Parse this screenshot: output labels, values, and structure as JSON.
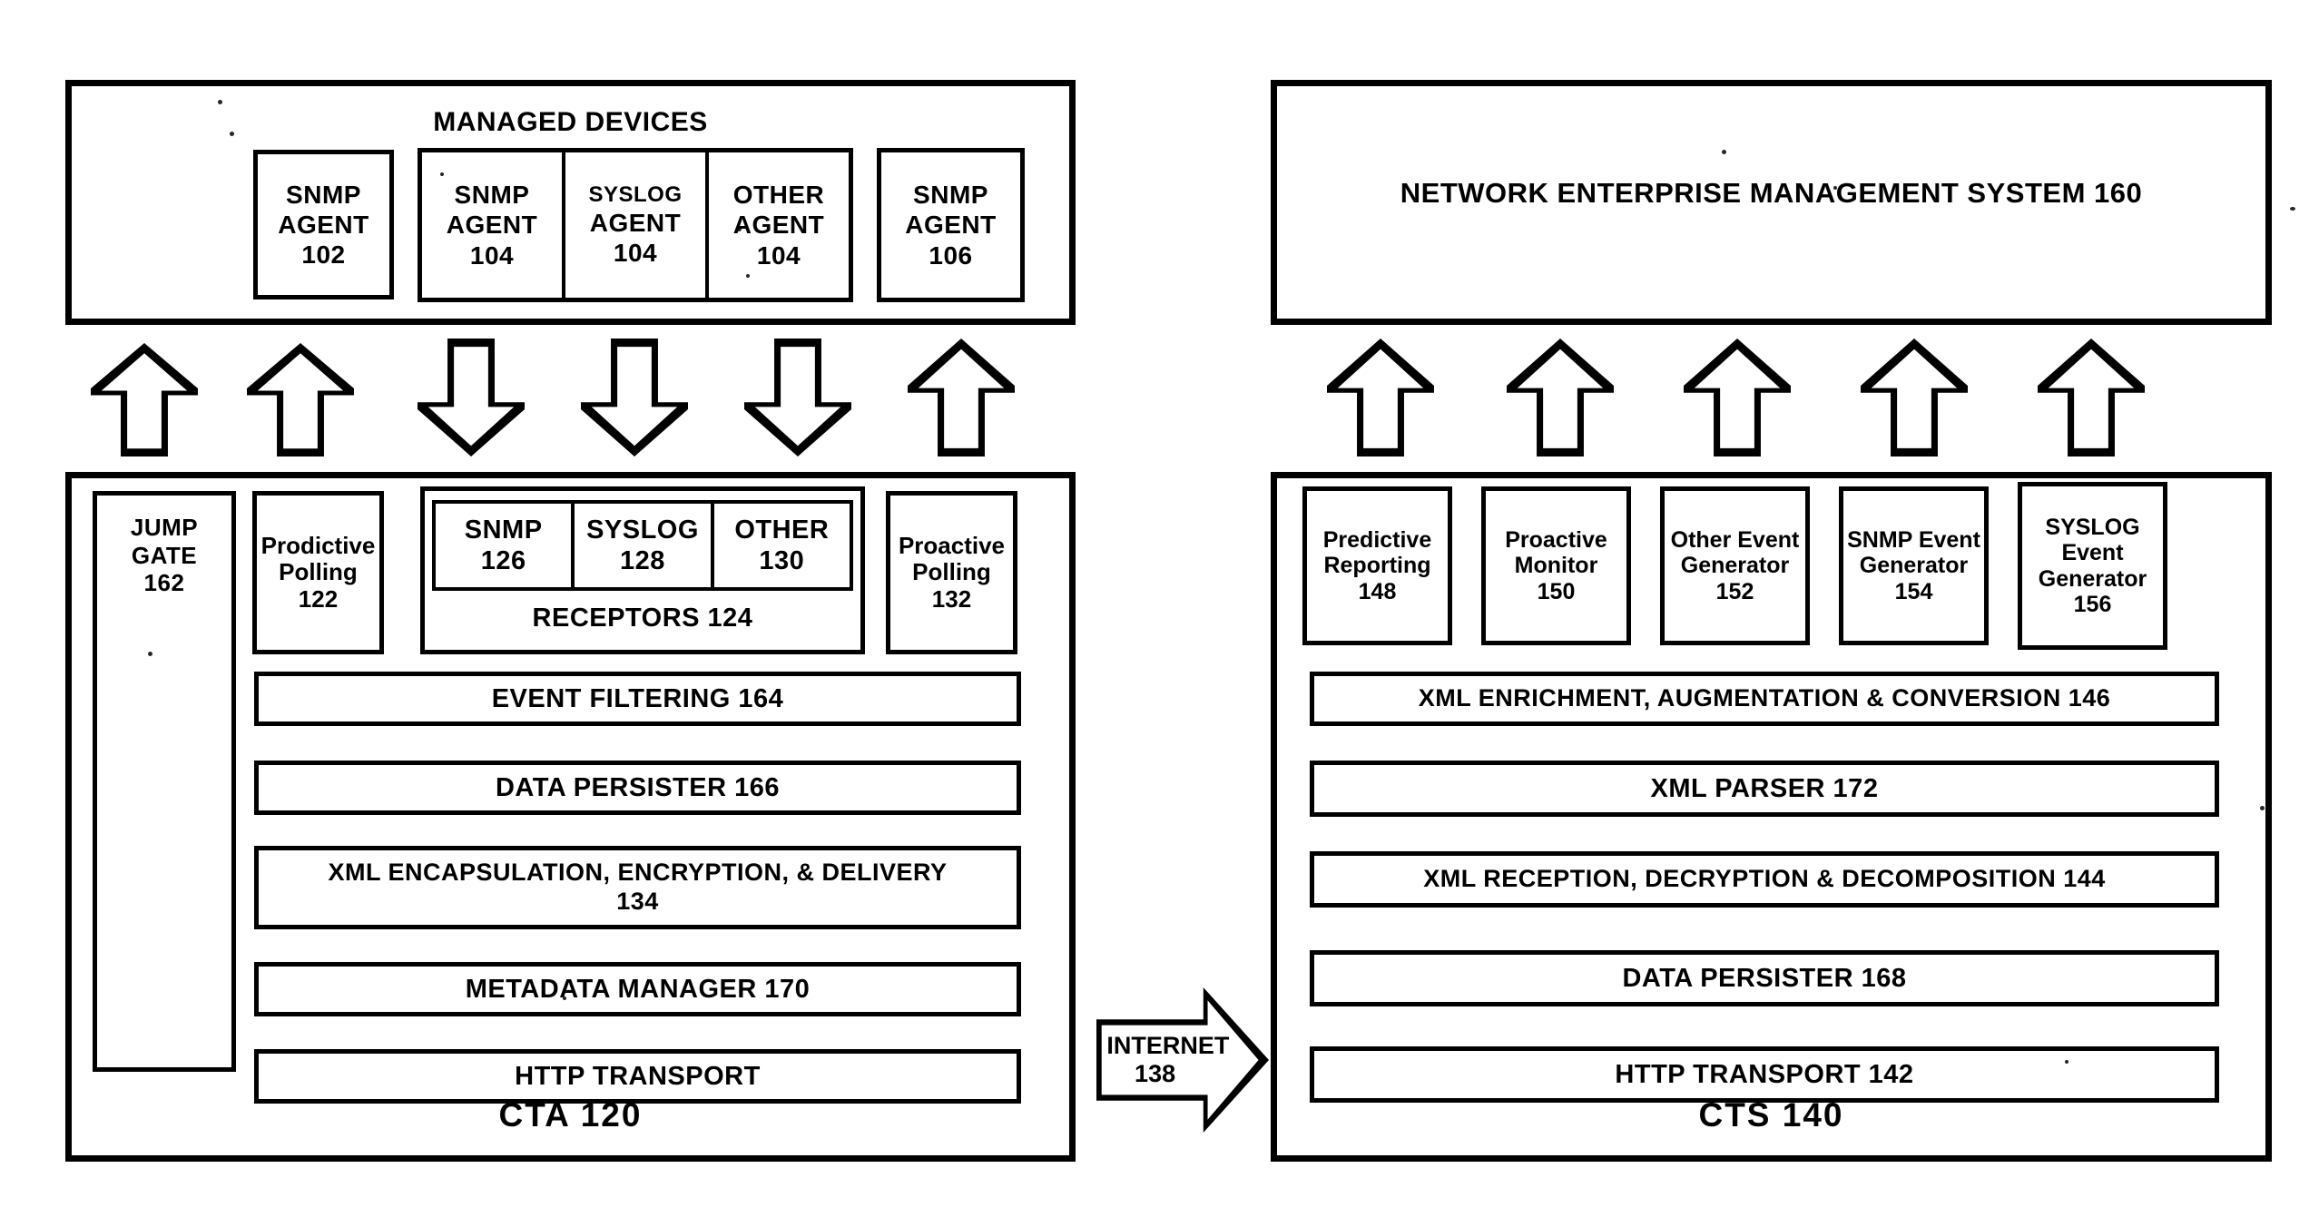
{
  "diagram": {
    "type": "patent-block-diagram",
    "background": "#ffffff",
    "ink": "#000000"
  },
  "left": {
    "managed_devices": {
      "title": "MANAGED DEVICES",
      "agents": [
        {
          "name": "SNMP",
          "role": "AGENT",
          "ref": "102",
          "group": "single-left"
        },
        {
          "name": "SNMP",
          "role": "AGENT",
          "ref": "104",
          "group": "triple"
        },
        {
          "name": "SYSLOG",
          "role": "AGENT",
          "ref": "104",
          "group": "triple"
        },
        {
          "name": "OTHER",
          "role": "AGENT",
          "ref": "104",
          "group": "triple"
        },
        {
          "name": "SNMP",
          "role": "AGENT",
          "ref": "106",
          "group": "single-right"
        }
      ]
    },
    "arrows": [
      {
        "direction": "up"
      },
      {
        "direction": "up"
      },
      {
        "direction": "down"
      },
      {
        "direction": "down"
      },
      {
        "direction": "down"
      },
      {
        "direction": "up"
      }
    ],
    "cta": {
      "footer": "CTA  120",
      "jump_gate": {
        "line1": "JUMP",
        "line2": "GATE",
        "ref": "162"
      },
      "prodictive_polling": {
        "line1": "Prodictive",
        "line2": "Polling",
        "ref": "122"
      },
      "receptors": {
        "label": "RECEPTORS  124",
        "items": [
          {
            "name": "SNMP",
            "ref": "126"
          },
          {
            "name": "SYSLOG",
            "ref": "128"
          },
          {
            "name": "OTHER",
            "ref": "130"
          }
        ]
      },
      "proactive_polling": {
        "line1": "Proactive",
        "line2": "Polling",
        "ref": "132"
      },
      "bars": [
        {
          "label": "EVENT FILTERING   164",
          "two_line": false
        },
        {
          "label": "DATA PERSISTER  166",
          "two_line": false
        },
        {
          "label": "XML ENCAPSULATION, ENCRYPTION, & DELIVERY",
          "label2": "134",
          "two_line": true
        },
        {
          "label": "METADATA MANAGER  170",
          "two_line": false
        },
        {
          "label": "HTTP TRANSPORT",
          "two_line": false
        }
      ]
    }
  },
  "middle": {
    "internet_arrow": {
      "line1": "INTERNET",
      "line2": "138"
    }
  },
  "right": {
    "nems": {
      "title": "NETWORK ENTERPRISE MANAGEMENT SYSTEM  160"
    },
    "arrows": [
      {
        "direction": "up"
      },
      {
        "direction": "up"
      },
      {
        "direction": "up"
      },
      {
        "direction": "up"
      },
      {
        "direction": "up"
      }
    ],
    "cts": {
      "footer": "CTS  140",
      "components": [
        {
          "lines": [
            "Predictive",
            "Reporting"
          ],
          "ref": "148"
        },
        {
          "lines": [
            "Proactive",
            "Monitor"
          ],
          "ref": "150"
        },
        {
          "lines": [
            "Other Event",
            "Generator"
          ],
          "ref": "152"
        },
        {
          "lines": [
            "SNMP Event",
            "Generator"
          ],
          "ref": "154"
        },
        {
          "lines": [
            "SYSLOG",
            "Event",
            "Generator"
          ],
          "ref": "156"
        }
      ],
      "bars": [
        {
          "label": "XML ENRICHMENT, AUGMENTATION & CONVERSION  146"
        },
        {
          "label": "XML PARSER  172"
        },
        {
          "label": "XML RECEPTION, DECRYPTION & DECOMPOSITION  144"
        },
        {
          "label": "DATA PERSISTER  168"
        },
        {
          "label": "HTTP TRANSPORT 142"
        }
      ]
    }
  }
}
